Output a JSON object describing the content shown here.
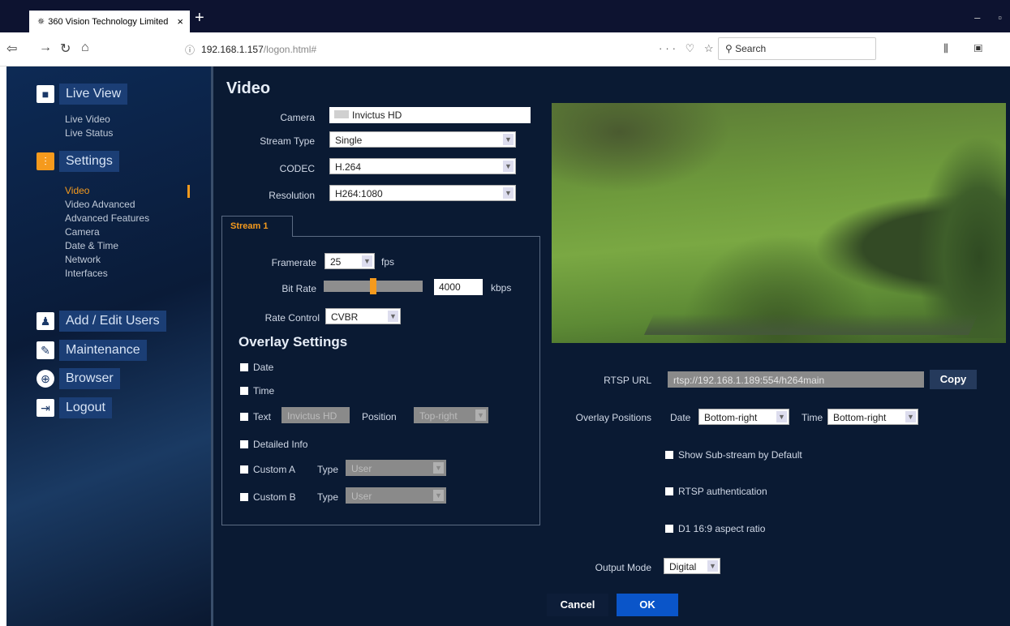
{
  "browser": {
    "tab_title": "360 Vision Technology Limited",
    "url_host": "192.168.1.157",
    "url_path": "/logon.html#",
    "search_placeholder": "Search"
  },
  "sidebar": {
    "live_view": {
      "label": "Live View",
      "items": [
        "Live Video",
        "Live Status"
      ]
    },
    "settings": {
      "label": "Settings",
      "items": [
        "Video",
        "Video Advanced",
        "Advanced Features",
        "Camera",
        "Date & Time",
        "Network",
        "Interfaces"
      ]
    },
    "add_edit_users": "Add / Edit Users",
    "maintenance": "Maintenance",
    "browser": "Browser",
    "logout": "Logout"
  },
  "video": {
    "title": "Video",
    "camera_label": "Camera",
    "camera_value": "Invictus HD",
    "stream_type_label": "Stream Type",
    "stream_type_value": "Single",
    "codec_label": "CODEC",
    "codec_value": "H.264",
    "resolution_label": "Resolution",
    "resolution_value": "H264:1080"
  },
  "stream": {
    "tab_label": "Stream 1",
    "framerate_label": "Framerate",
    "framerate_value": "25",
    "framerate_unit": "fps",
    "bitrate_label": "Bit Rate",
    "bitrate_value": "4000",
    "bitrate_unit": "kbps",
    "bitrate_slider_fraction": 0.5,
    "rate_control_label": "Rate Control",
    "rate_control_value": "CVBR"
  },
  "overlay": {
    "title": "Overlay Settings",
    "date": "Date",
    "time": "Time",
    "text": "Text",
    "text_value": "Invictus HD",
    "position_label": "Position",
    "position_value": "Top-right",
    "detailed_info": "Detailed Info",
    "custom_a": "Custom A",
    "custom_b": "Custom B",
    "type_label": "Type",
    "type_value": "User"
  },
  "right": {
    "rtsp_label": "RTSP URL",
    "rtsp_value": "rtsp://192.168.1.189:554/h264main",
    "copy": "Copy",
    "overlay_positions_label": "Overlay Positions",
    "date_label": "Date",
    "date_pos": "Bottom-right",
    "time_label": "Time",
    "time_pos": "Bottom-right",
    "show_substream": "Show Sub-stream by Default",
    "rtsp_auth": "RTSP authentication",
    "d1_aspect": "D1 16:9 aspect ratio",
    "output_mode_label": "Output Mode",
    "output_mode_value": "Digital"
  },
  "actions": {
    "cancel": "Cancel",
    "ok": "OK"
  },
  "colors": {
    "accent": "#f59a1d",
    "background": "#0a1a33",
    "ok_button": "#0a55c9"
  }
}
